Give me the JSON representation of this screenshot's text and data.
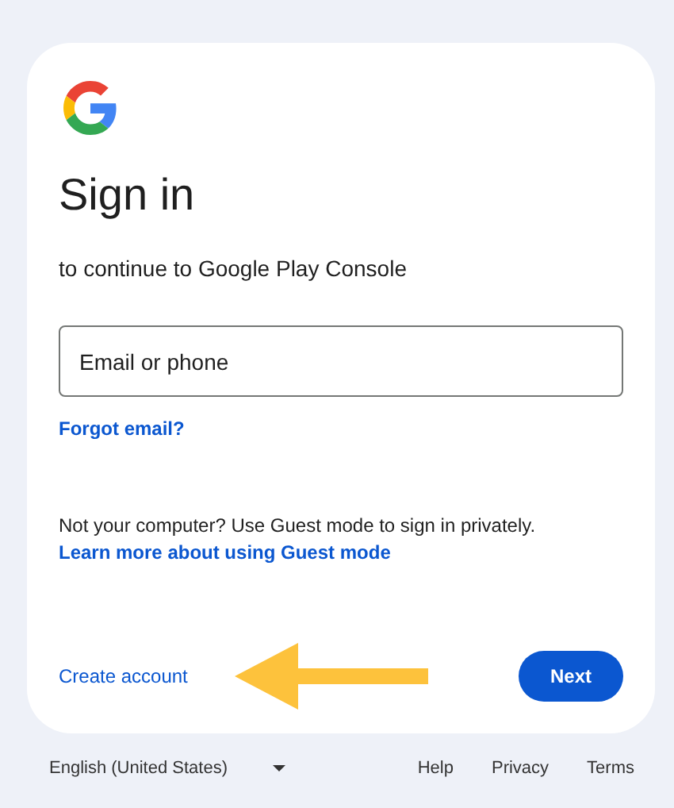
{
  "card": {
    "title": "Sign in",
    "subtitle": "to continue to Google Play Console",
    "email_field": {
      "placeholder": "Email or phone"
    },
    "forgot_link": "Forgot email?",
    "guest_notice": {
      "text": "Not your computer? Use Guest mode to sign in privately.",
      "link": "Learn more about using Guest mode"
    },
    "create_account": "Create account",
    "next_button": "Next"
  },
  "footer": {
    "language": "English (United States)",
    "links": [
      "Help",
      "Privacy",
      "Terms"
    ]
  }
}
